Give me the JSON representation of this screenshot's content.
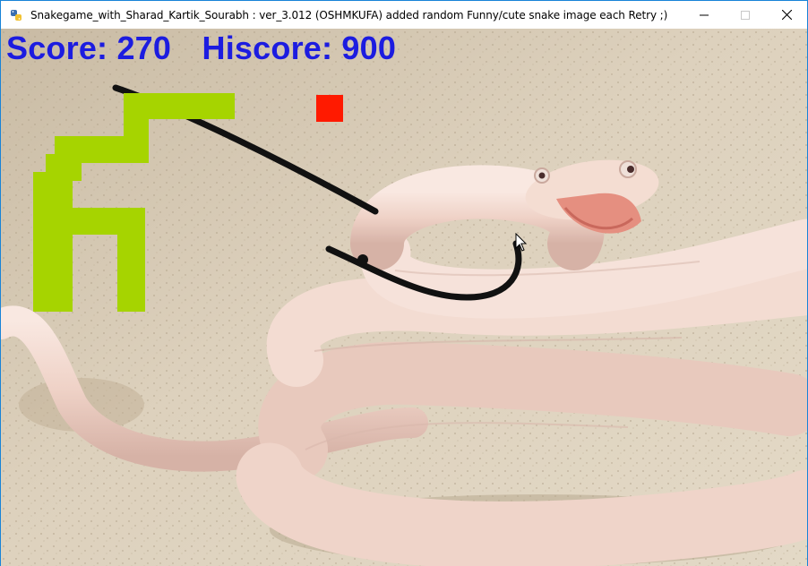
{
  "window": {
    "title": "Snakegame_with_Sharad_Kartik_Sourabh :  ver_3.012 (OSHMKUFA) added random Funny/cute snake image each Retry ;)",
    "app_icon": "python-icon",
    "controls": [
      "minimize-icon",
      "maximize-icon",
      "close-icon"
    ]
  },
  "game": {
    "score_label": "Score:",
    "score_value": "270",
    "hiscore_label": "Hiscore:",
    "hiscore_value": "900",
    "colors": {
      "score_text": "#1c1ce0",
      "snake": "#a6d400",
      "food": "#ff1a00",
      "background_sand": "#d9cdb8",
      "photo_snake_body": "#f0d6cc"
    },
    "background_image": "albino-snake-photo"
  }
}
